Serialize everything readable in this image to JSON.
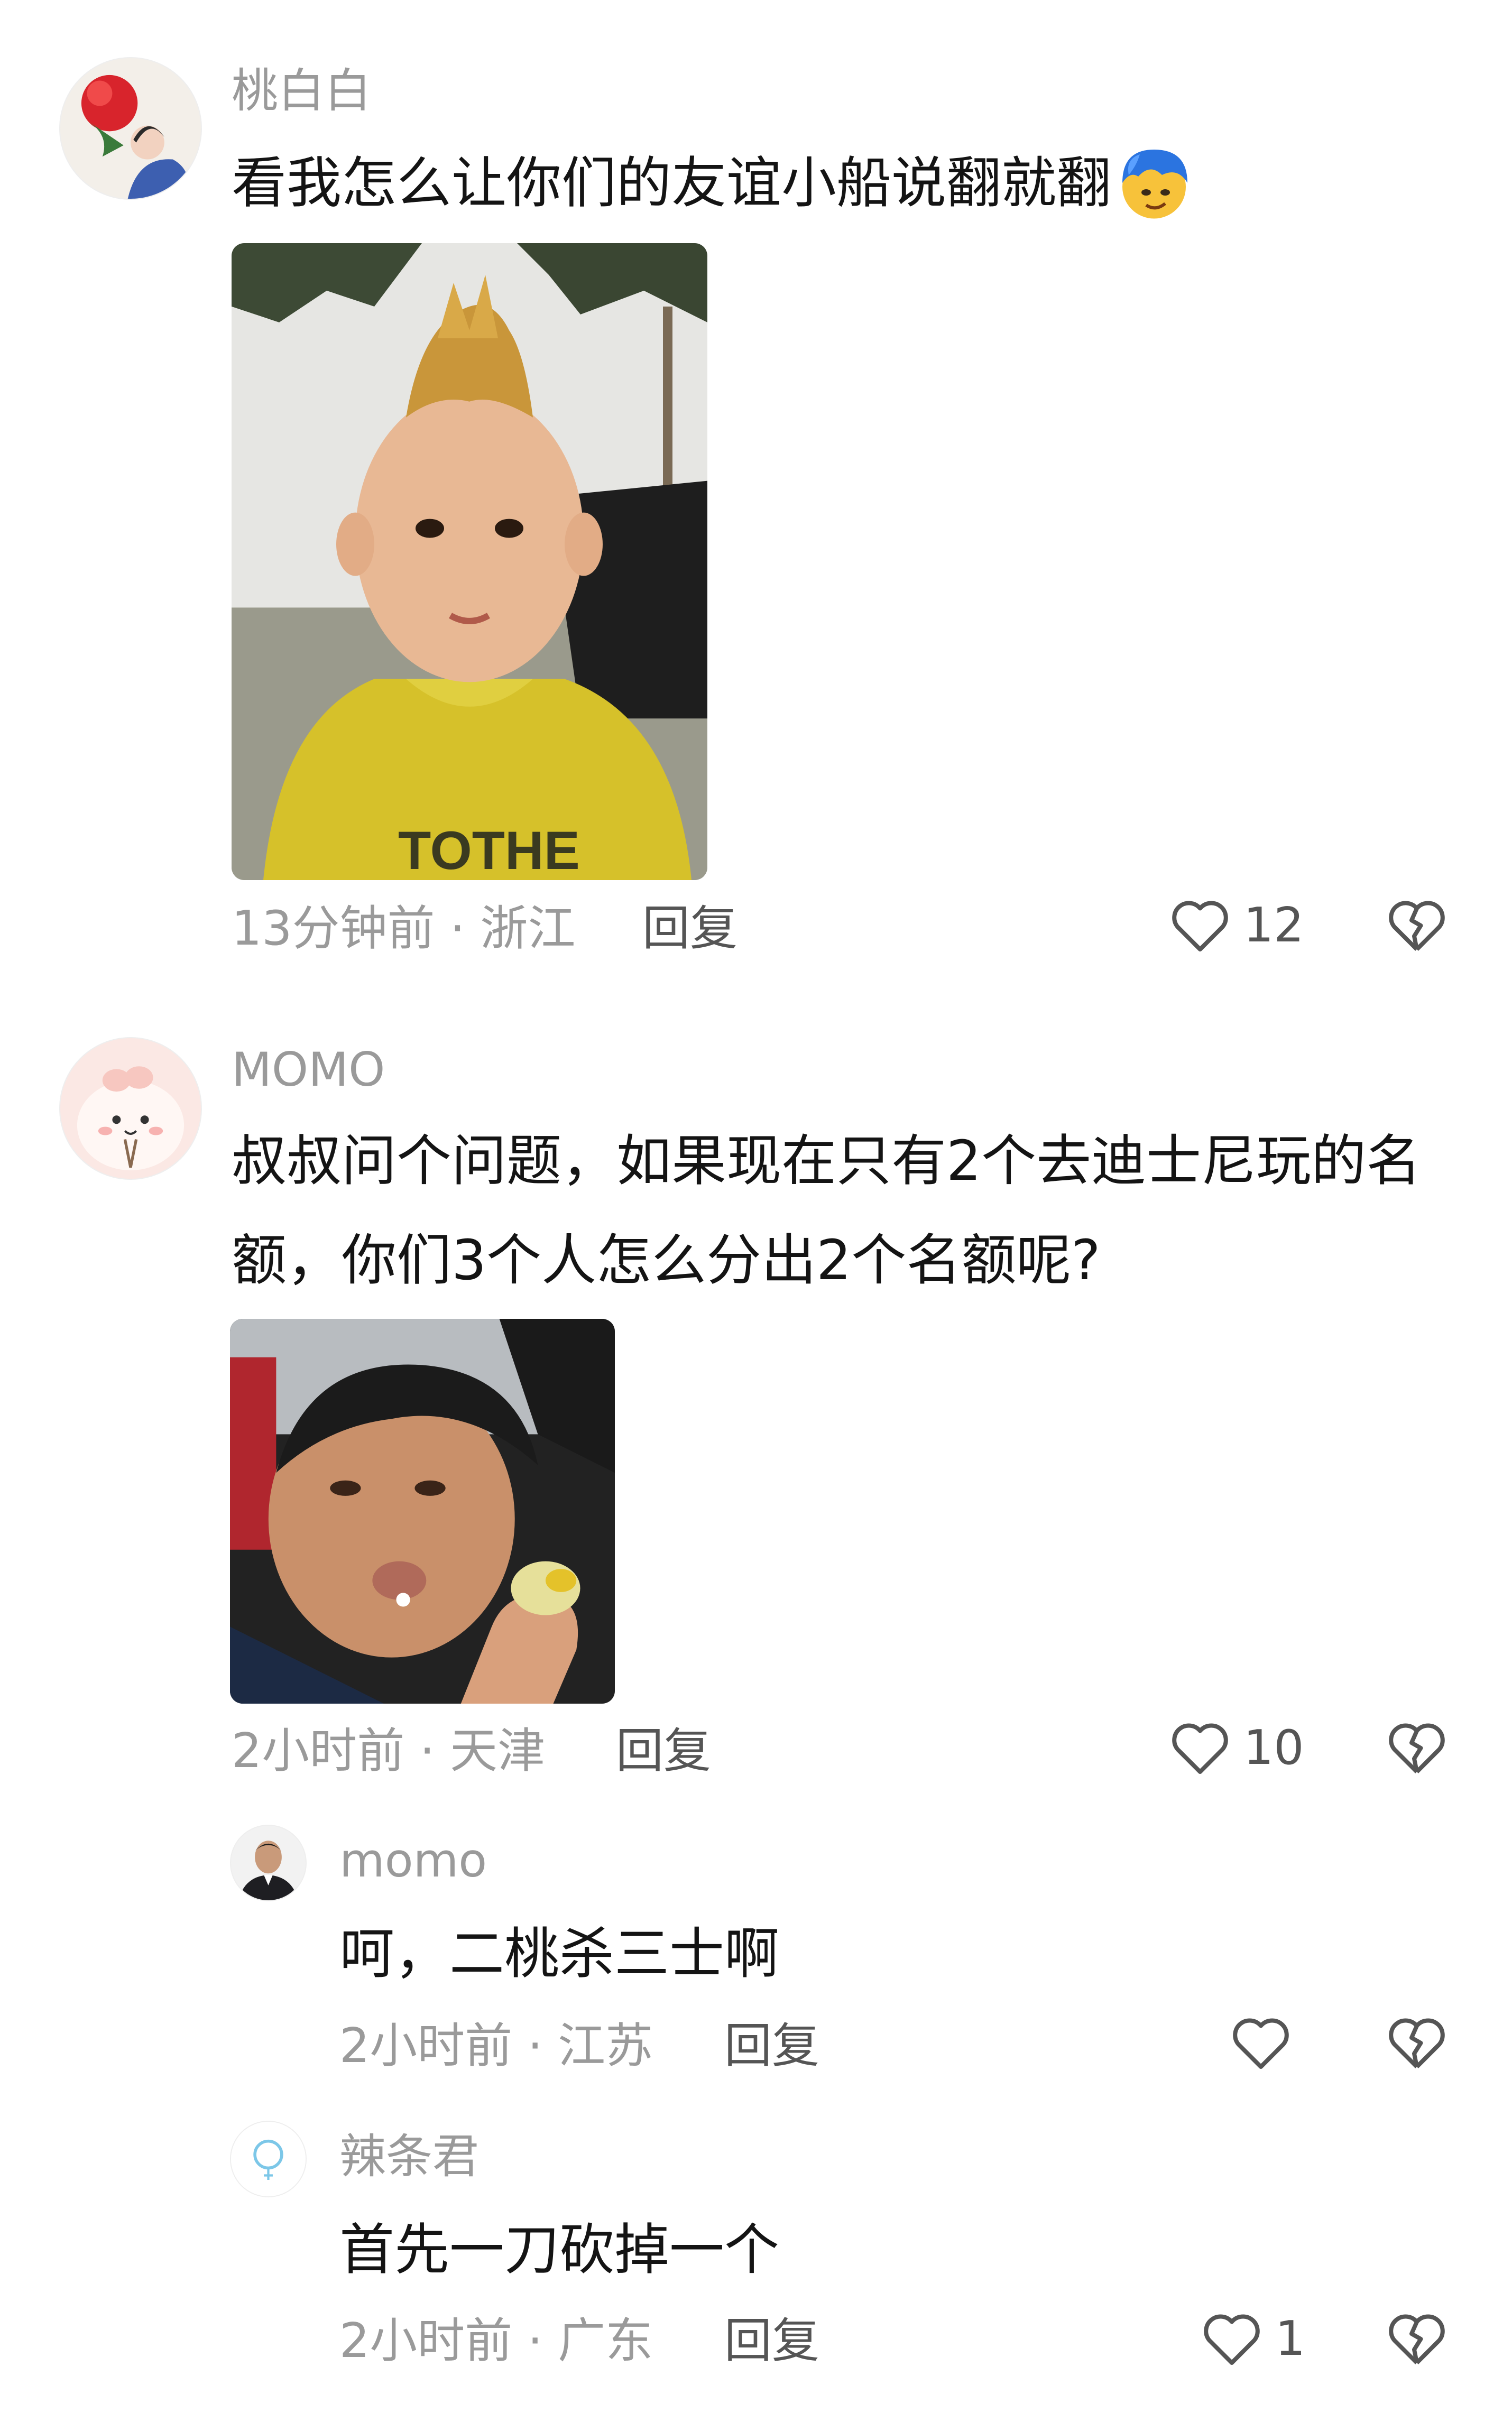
{
  "comments": [
    {
      "username": "桃白白",
      "text": "看我怎么让你们的友谊小船说翻就翻",
      "emoji_icon": "blue-haired-face-emoji-icon",
      "time_location": "13分钟前 · 浙江",
      "reply_label": "回复",
      "likes": "12",
      "photo_icon": "boy-with-mohawk-photo"
    },
    {
      "username": "MOMO",
      "text_line1": "叔叔问个问题，如果现在只有2个去迪士尼玩的名",
      "text_line2": "额，你们3个人怎么分出2个名额呢?",
      "time_location": "2小时前 · 天津",
      "reply_label": "回复",
      "likes": "10",
      "photo_icon": "man-eating-photo"
    },
    {
      "username": "momo",
      "text": "呵，二桃杀三士啊",
      "time_location": "2小时前 · 江苏",
      "reply_label": "回复",
      "likes": ""
    },
    {
      "username": "辣条君",
      "text": "首先一刀砍掉一个",
      "time_location": "2小时前 · 广东",
      "reply_label": "回复",
      "likes": "1"
    }
  ]
}
